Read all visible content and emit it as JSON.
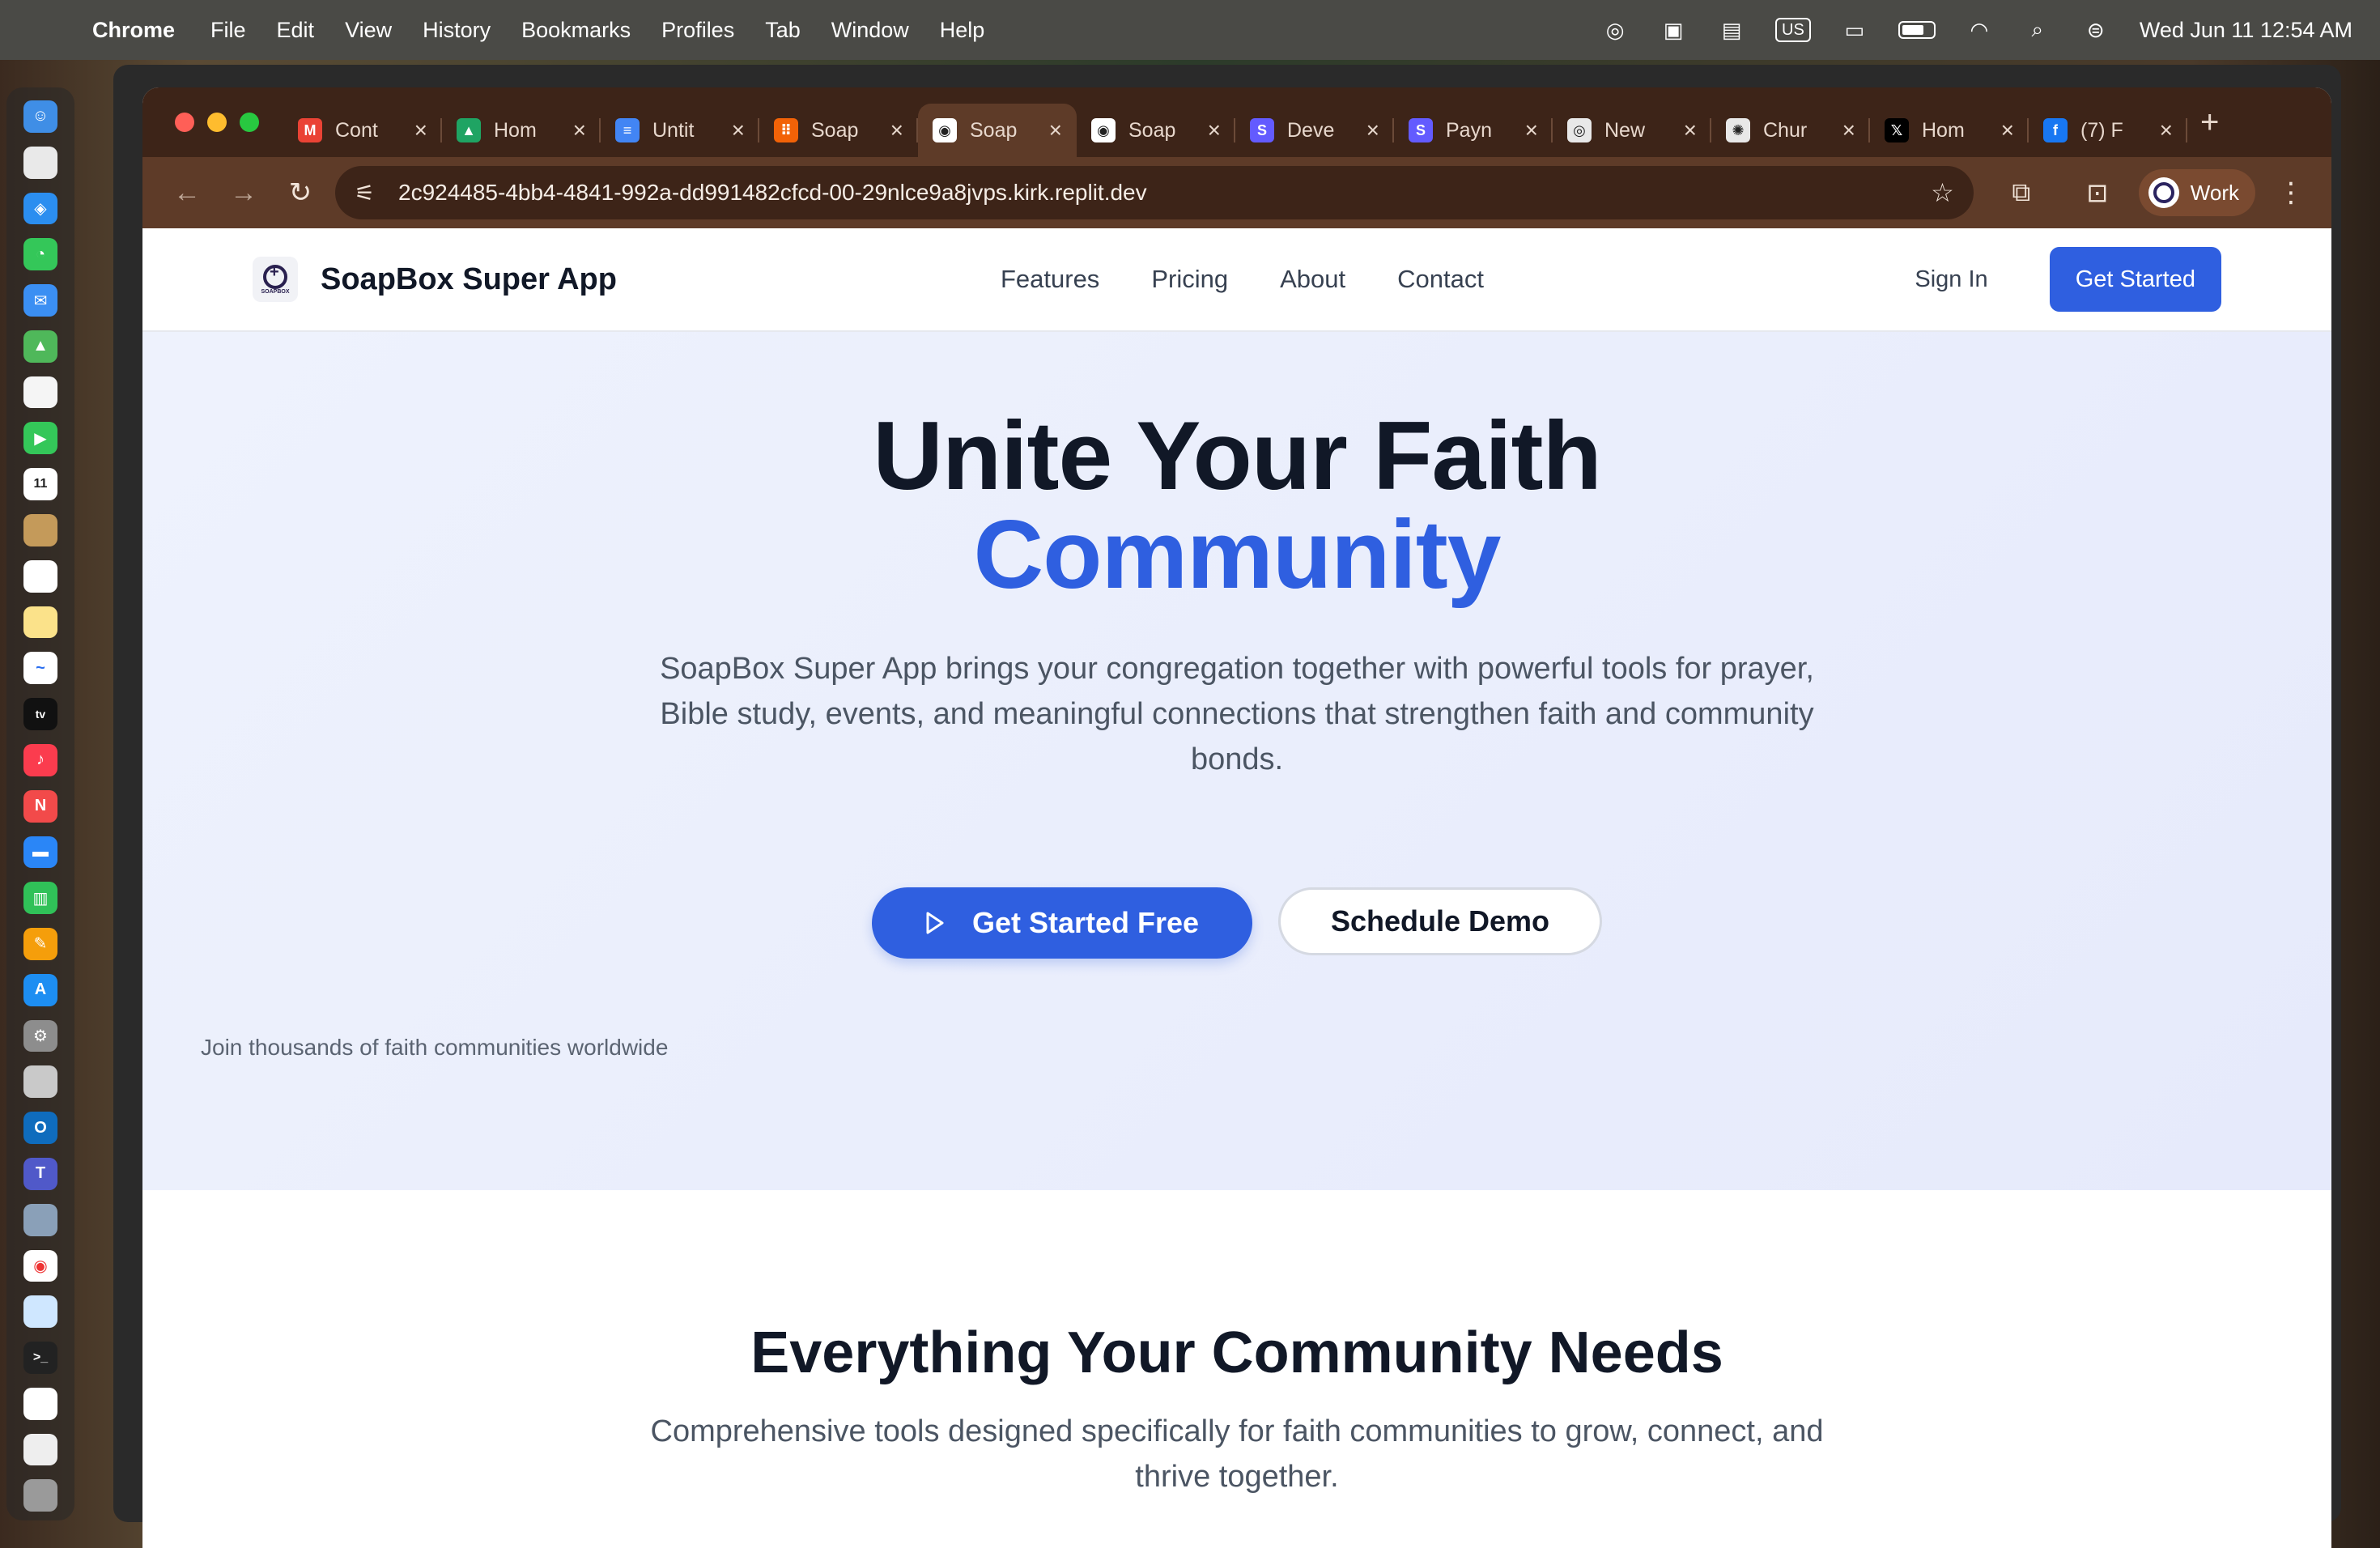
{
  "menubar": {
    "app": "Chrome",
    "menus": [
      "File",
      "Edit",
      "View",
      "History",
      "Bookmarks",
      "Profiles",
      "Tab",
      "Window",
      "Help"
    ],
    "input_source": "US",
    "clock": "Wed Jun 11  12:54 AM"
  },
  "tabs": [
    {
      "label": "Cont",
      "icon": "gmail-icon",
      "color": "#ea4335",
      "glyph": "M"
    },
    {
      "label": "Hom",
      "icon": "drive-icon",
      "color": "#1fa463",
      "glyph": "▲"
    },
    {
      "label": "Untit",
      "icon": "docs-icon",
      "color": "#4285f4",
      "glyph": "≡"
    },
    {
      "label": "Soap",
      "icon": "replit-icon",
      "color": "#f26207",
      "glyph": "⠿"
    },
    {
      "label": "Soap",
      "icon": "soapbox-icon",
      "color": "#ffffff",
      "glyph": "◉",
      "active": true
    },
    {
      "label": "Soap",
      "icon": "soapbox-icon",
      "color": "#ffffff",
      "glyph": "◉"
    },
    {
      "label": "Deve",
      "icon": "stripe-icon",
      "color": "#635bff",
      "glyph": "S"
    },
    {
      "label": "Payn",
      "icon": "stripe-icon",
      "color": "#635bff",
      "glyph": "S"
    },
    {
      "label": "New",
      "icon": "chrome-icon",
      "color": "#e8e8e8",
      "glyph": "◎"
    },
    {
      "label": "Chur",
      "icon": "chatgpt-icon",
      "color": "#e8e8e8",
      "glyph": "✺"
    },
    {
      "label": "Hom",
      "icon": "x-icon",
      "color": "#000000",
      "glyph": "𝕏"
    },
    {
      "label": "(7) F",
      "icon": "facebook-icon",
      "color": "#1877f2",
      "glyph": "f"
    }
  ],
  "toolbar": {
    "url": "2c924485-4bb4-4841-992a-dd991482cfcd-00-29nlce9a8jvps.kirk.replit.dev",
    "profile_label": "Work"
  },
  "site": {
    "brand": "SoapBox Super App",
    "logo_text": "SOAPBOX",
    "nav": [
      "Features",
      "Pricing",
      "About",
      "Contact"
    ],
    "sign_in": "Sign In",
    "get_started": "Get Started",
    "hero": {
      "title_line1": "Unite Your Faith",
      "title_line2": "Community",
      "lead": "SoapBox Super App brings your congregation together with powerful tools for prayer, Bible study, events, and meaningful connections that strengthen faith and community bonds.",
      "primary_cta": "Get Started Free",
      "secondary_cta": "Schedule Demo",
      "social_proof": "Join thousands of faith communities worldwide"
    },
    "features": {
      "heading": "Everything Your Community Needs",
      "subheading": "Comprehensive tools designed specifically for faith communities to grow, connect, and thrive together."
    }
  },
  "colors": {
    "accent": "#2f5fe0",
    "chrome_frame": "#3d2418",
    "chrome_toolbar": "#5e3b28"
  }
}
